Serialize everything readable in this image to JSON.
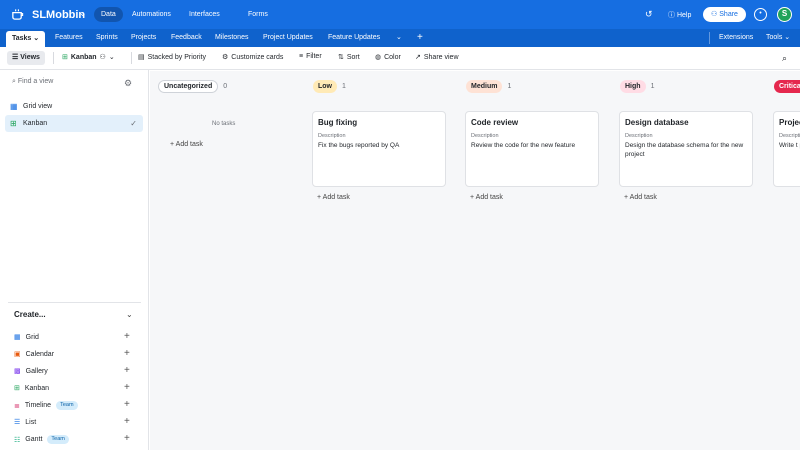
{
  "app": {
    "name": "SLMobbin"
  },
  "top_nav": [
    "Data",
    "Automations",
    "Interfaces",
    "Forms"
  ],
  "top_right": {
    "help": "Help",
    "share": "Share",
    "avatar_initial": "S"
  },
  "tabs": {
    "items": [
      "Tasks",
      "Features",
      "Sprints",
      "Projects",
      "Feedback",
      "Milestones",
      "Project Updates",
      "Feature Updates"
    ],
    "extensions": "Extensions",
    "tools": "Tools"
  },
  "toolbar": {
    "views": "Views",
    "kanban": "Kanban",
    "stacked": "Stacked by Priority",
    "customize": "Customize cards",
    "filter": "Filter",
    "sort": "Sort",
    "color": "Color",
    "share_view": "Share view"
  },
  "sidebar": {
    "find_placeholder": "Find a view",
    "views": [
      {
        "label": "Grid view",
        "icon": "grid-icon"
      },
      {
        "label": "Kanban",
        "icon": "kanban-icon"
      }
    ],
    "create_label": "Create...",
    "create_items": [
      {
        "label": "Grid",
        "icon": "grid-icon",
        "color": "#166ee1"
      },
      {
        "label": "Calendar",
        "icon": "calendar-icon",
        "color": "#e8590c"
      },
      {
        "label": "Gallery",
        "icon": "gallery-icon",
        "color": "#7c3aed"
      },
      {
        "label": "Kanban",
        "icon": "kanban-icon",
        "color": "#20a35a"
      },
      {
        "label": "Timeline",
        "icon": "timeline-icon",
        "color": "#d6336c",
        "badge": "Team"
      },
      {
        "label": "List",
        "icon": "list-icon",
        "color": "#166ee1"
      },
      {
        "label": "Gantt",
        "icon": "gantt-icon",
        "color": "#0ca678",
        "badge": "Team"
      }
    ]
  },
  "board": {
    "no_tasks": "No tasks",
    "add_task": "Add task",
    "description_label": "Description",
    "columns": [
      {
        "name": "Uncategorized",
        "count": "0",
        "color": "#ffffff"
      },
      {
        "name": "Low",
        "count": "1",
        "color": "#ffeab6",
        "card": {
          "title": "Bug fixing",
          "desc": "Fix the bugs reported by QA"
        }
      },
      {
        "name": "Medium",
        "count": "1",
        "color": "#fee2d5",
        "card": {
          "title": "Code review",
          "desc": "Review the code for the new feature"
        }
      },
      {
        "name": "High",
        "count": "1",
        "color": "#ffdce5",
        "card": {
          "title": "Design database",
          "desc": "Design the database schema for the new project"
        }
      },
      {
        "name": "Critical",
        "count": "",
        "color": "#e5284e",
        "card": {
          "title": "Project",
          "desc": "Write t project"
        }
      }
    ]
  }
}
